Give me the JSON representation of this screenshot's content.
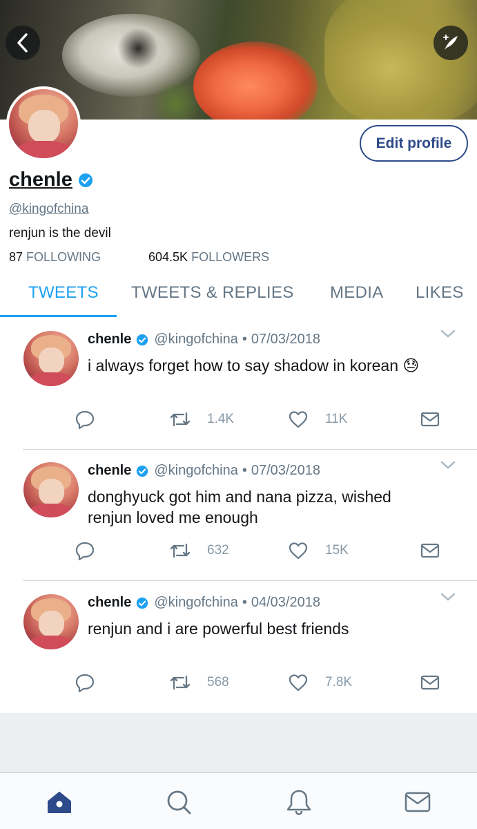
{
  "header": {
    "back_icon": "chevron-left-icon",
    "compose_icon": "compose-quill-icon"
  },
  "profile": {
    "edit_label": "Edit profile",
    "display_name": "chenle",
    "handle": "@kingofchina",
    "bio": "renjun is the devil",
    "following_count": "87",
    "following_label": "FOLLOWING",
    "followers_count": "604.5K",
    "followers_label": "FOLLOWERS",
    "verified": true
  },
  "tabs": [
    {
      "label": "TWEETS",
      "active": true
    },
    {
      "label": "TWEETS & REPLIES",
      "active": false
    },
    {
      "label": "MEDIA",
      "active": false
    },
    {
      "label": "LIKES",
      "active": false
    }
  ],
  "tweets": [
    {
      "name": "chenle",
      "handle": "@kingofchina",
      "separator": "•",
      "date": "07/03/2018",
      "text": "i always forget how to say shadow in korean",
      "emoji": "😓",
      "retweets": "1.4K",
      "likes": "11K"
    },
    {
      "name": "chenle",
      "handle": "@kingofchina",
      "separator": "•",
      "date": "07/03/2018",
      "text": "donghyuck got him and nana pizza, wished renjun loved me enough",
      "emoji": "",
      "retweets": "632",
      "likes": "15K"
    },
    {
      "name": "chenle",
      "handle": "@kingofchina",
      "separator": "•",
      "date": "04/03/2018",
      "text": "renjun and i are powerful best friends",
      "emoji": "",
      "retweets": "568",
      "likes": "7.8K"
    }
  ],
  "bottom_nav": [
    {
      "icon": "home-icon",
      "active": true
    },
    {
      "icon": "search-icon",
      "active": false
    },
    {
      "icon": "bell-icon",
      "active": false
    },
    {
      "icon": "mail-icon",
      "active": false
    }
  ],
  "colors": {
    "accent": "#1da1f2",
    "nav_active": "#2d4a8a",
    "muted": "#657786"
  }
}
